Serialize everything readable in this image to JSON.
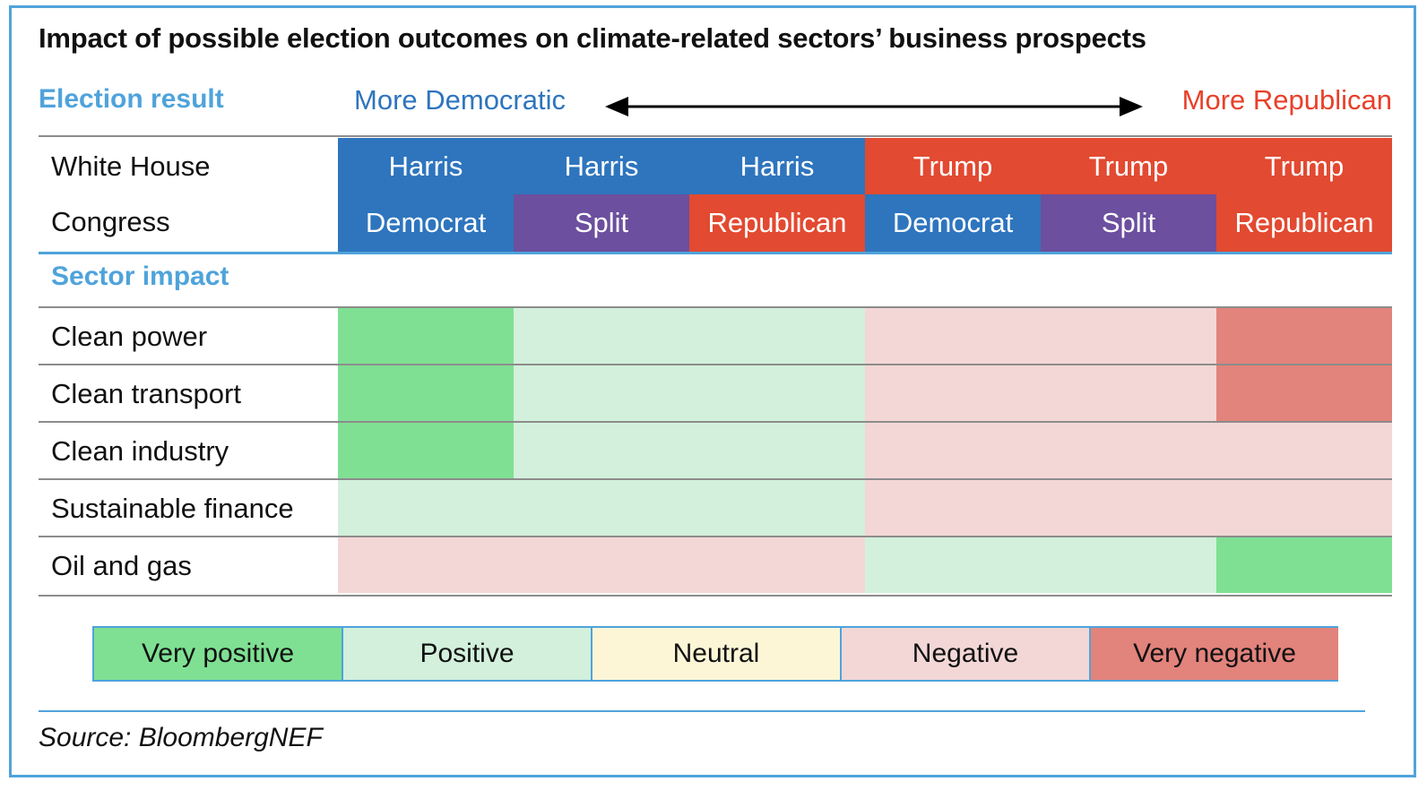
{
  "title": "Impact of possible election outcomes on climate-related sectors’ business prospects",
  "election": {
    "label": "Election result",
    "more_democratic": "More Democratic",
    "more_republican": "More Republican",
    "row_labels": [
      "White House",
      "Congress"
    ],
    "white_house": [
      "Harris",
      "Harris",
      "Harris",
      "Trump",
      "Trump",
      "Trump"
    ],
    "congress": [
      "Democrat",
      "Split",
      "Republican",
      "Democrat",
      "Split",
      "Republican"
    ],
    "white_house_colors": [
      "#2E75BE",
      "#2E75BE",
      "#2E75BE",
      "#E24A31",
      "#E24A31",
      "#E24A31"
    ],
    "congress_colors": [
      "#2E75BE",
      "#6C4F9E",
      "#E24A31",
      "#2E75BE",
      "#6C4F9E",
      "#E24A31"
    ]
  },
  "sector": {
    "label": "Sector impact"
  },
  "legend": {
    "items": [
      {
        "label": "Very positive",
        "color": "#7FE093"
      },
      {
        "label": "Positive",
        "color": "#D2F0DB"
      },
      {
        "label": "Neutral",
        "color": "#FCF6D7"
      },
      {
        "label": "Negative",
        "color": "#F3D7D6"
      },
      {
        "label": "Very negative",
        "color": "#E2837C"
      }
    ]
  },
  "source": "Source: BloombergNEF",
  "colors": {
    "frame": "#4FA3DB",
    "accent_blue": "#4FA3DB",
    "democrat_blue": "#2E75BE",
    "republican_red": "#E24A31",
    "split_purple": "#6C4F9E",
    "more_democratic_text": "#2E75BE",
    "more_republican_text": "#E8402A",
    "rule_grey": "#8C8C8C"
  },
  "chart_data": {
    "type": "heatmap",
    "title": "Impact of possible election outcomes on climate-related sectors’ business prospects",
    "xlabel": "Election result",
    "ylabel": "Sector impact",
    "legend_position": "bottom",
    "grid": true,
    "scale": [
      "Very positive",
      "Positive",
      "Neutral",
      "Negative",
      "Very negative"
    ],
    "scale_colors": [
      "#7FE093",
      "#D2F0DB",
      "#FCF6D7",
      "#F3D7D6",
      "#E2837C"
    ],
    "categories": [
      "Harris / Democrat",
      "Harris / Split",
      "Harris / Republican",
      "Trump / Democrat",
      "Trump / Split",
      "Trump / Republican"
    ],
    "rows": [
      {
        "label": "Clean power",
        "values": [
          "Very positive",
          "Positive",
          "Positive",
          "Negative",
          "Negative",
          "Very negative"
        ],
        "colors": [
          "#7FE093",
          "#D2F0DB",
          "#D2F0DB",
          "#F3D7D6",
          "#F3D7D6",
          "#E2837C"
        ]
      },
      {
        "label": "Clean transport",
        "values": [
          "Very positive",
          "Positive",
          "Positive",
          "Negative",
          "Negative",
          "Very negative"
        ],
        "colors": [
          "#7FE093",
          "#D2F0DB",
          "#D2F0DB",
          "#F3D7D6",
          "#F3D7D6",
          "#E2837C"
        ]
      },
      {
        "label": "Clean industry",
        "values": [
          "Very positive",
          "Positive",
          "Positive",
          "Negative",
          "Negative",
          "Negative"
        ],
        "colors": [
          "#7FE093",
          "#D2F0DB",
          "#D2F0DB",
          "#F3D7D6",
          "#F3D7D6",
          "#F3D7D6"
        ]
      },
      {
        "label": "Sustainable finance",
        "values": [
          "Positive",
          "Positive",
          "Positive",
          "Negative",
          "Negative",
          "Negative"
        ],
        "colors": [
          "#D2F0DB",
          "#D2F0DB",
          "#D2F0DB",
          "#F3D7D6",
          "#F3D7D6",
          "#F3D7D6"
        ]
      },
      {
        "label": "Oil and gas",
        "values": [
          "Negative",
          "Negative",
          "Negative",
          "Positive",
          "Positive",
          "Very positive"
        ],
        "colors": [
          "#F3D7D6",
          "#F3D7D6",
          "#F3D7D6",
          "#D2F0DB",
          "#D2F0DB",
          "#7FE093"
        ]
      }
    ]
  }
}
